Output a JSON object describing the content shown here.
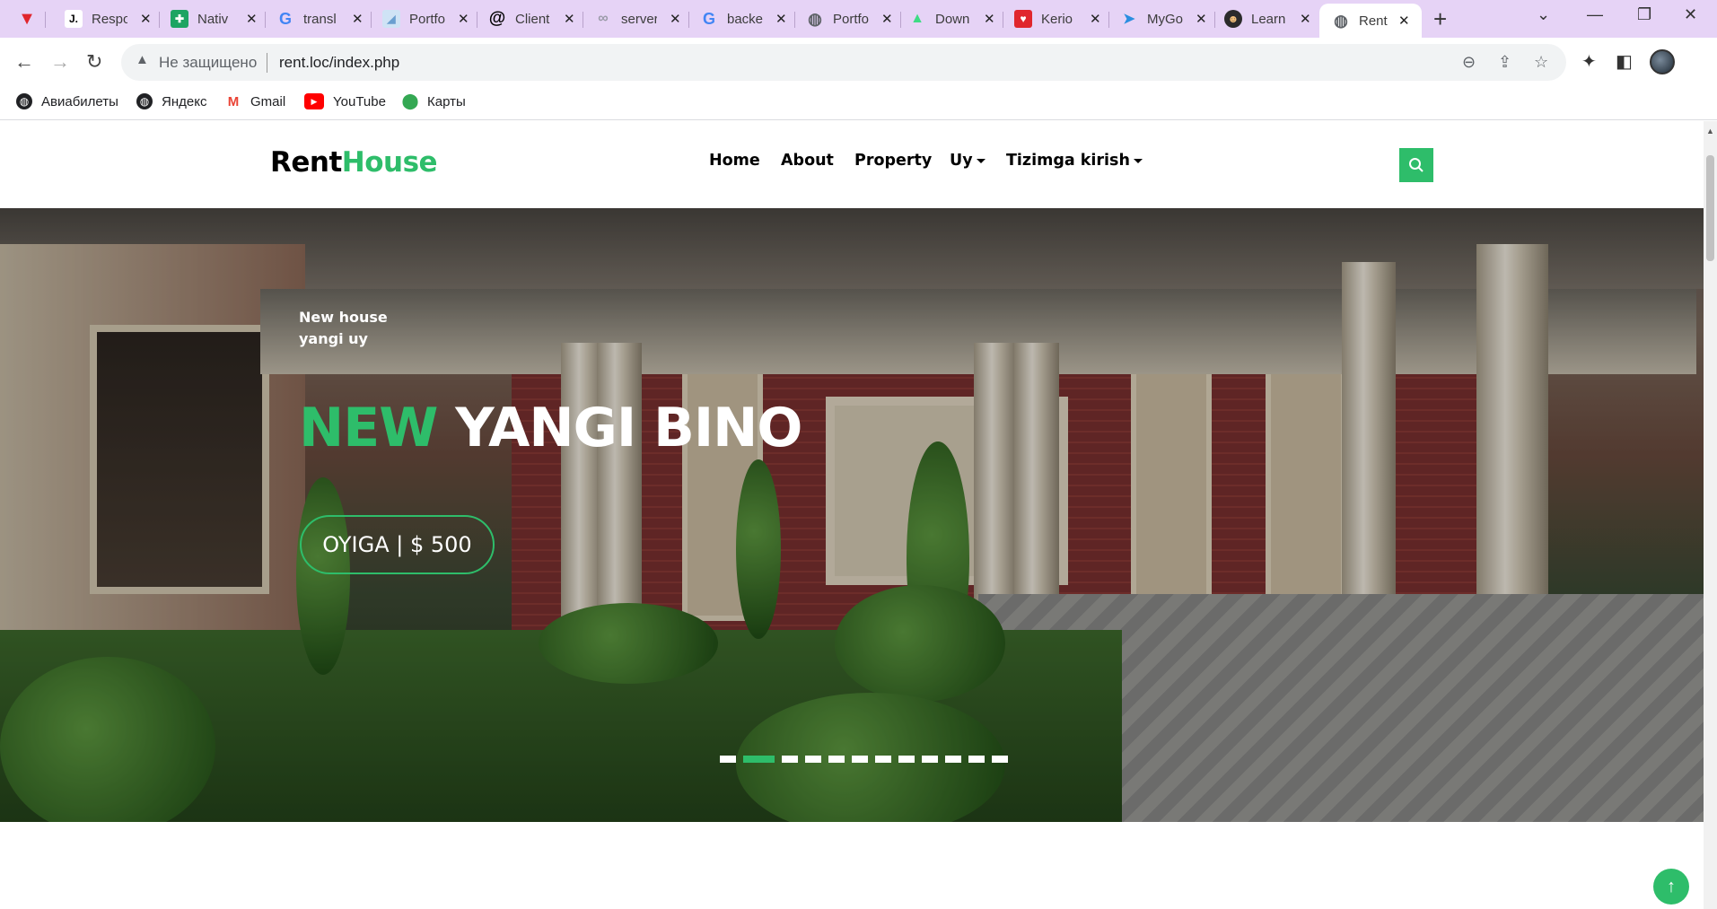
{
  "browser": {
    "tabs": [
      {
        "title": "",
        "icon": "vivaldi-icon"
      },
      {
        "title": "Respo",
        "icon": "j-icon"
      },
      {
        "title": "Nativ",
        "icon": "native-icon"
      },
      {
        "title": "transl",
        "icon": "google-icon"
      },
      {
        "title": "Portfo",
        "icon": "image-icon"
      },
      {
        "title": "Client",
        "icon": "at-icon"
      },
      {
        "title": "server",
        "icon": "link-icon"
      },
      {
        "title": "backe",
        "icon": "google-icon"
      },
      {
        "title": "Portfo",
        "icon": "globe-icon"
      },
      {
        "title": "Down",
        "icon": "android-icon"
      },
      {
        "title": "Kerio",
        "icon": "shield-icon"
      },
      {
        "title": "MyGo",
        "icon": "bird-icon"
      },
      {
        "title": "Learn",
        "icon": "ninja-icon"
      },
      {
        "title": "Rent",
        "icon": "globe-icon"
      }
    ],
    "close_glyph": "✕",
    "new_tab_glyph": "+",
    "security_label": "Не защищено",
    "url": "rent.loc/index.php",
    "bookmarks": [
      {
        "label": "Авиабилеты",
        "icon": "globe-icon"
      },
      {
        "label": "Яндекс",
        "icon": "globe-icon"
      },
      {
        "label": "Gmail",
        "icon": "gmail-icon"
      },
      {
        "label": "YouTube",
        "icon": "youtube-icon"
      },
      {
        "label": "Карты",
        "icon": "maps-icon"
      }
    ]
  },
  "site": {
    "logo_part1": "Rent",
    "logo_part2": "House",
    "nav": {
      "home": "Home",
      "about": "About",
      "property": "Property",
      "uy": "Uy",
      "login": "Tizimga kirish"
    },
    "hero": {
      "sub1": "New house",
      "sub2": "yangi uy",
      "title_accent": "NEW",
      "title_rest": " YANGI BINO",
      "price_button": "OYIGA | $ 500",
      "slide_count": 12,
      "active_slide": 2
    }
  },
  "colors": {
    "accent": "#2ebd6a",
    "tabstrip": "#e6d3f6"
  }
}
